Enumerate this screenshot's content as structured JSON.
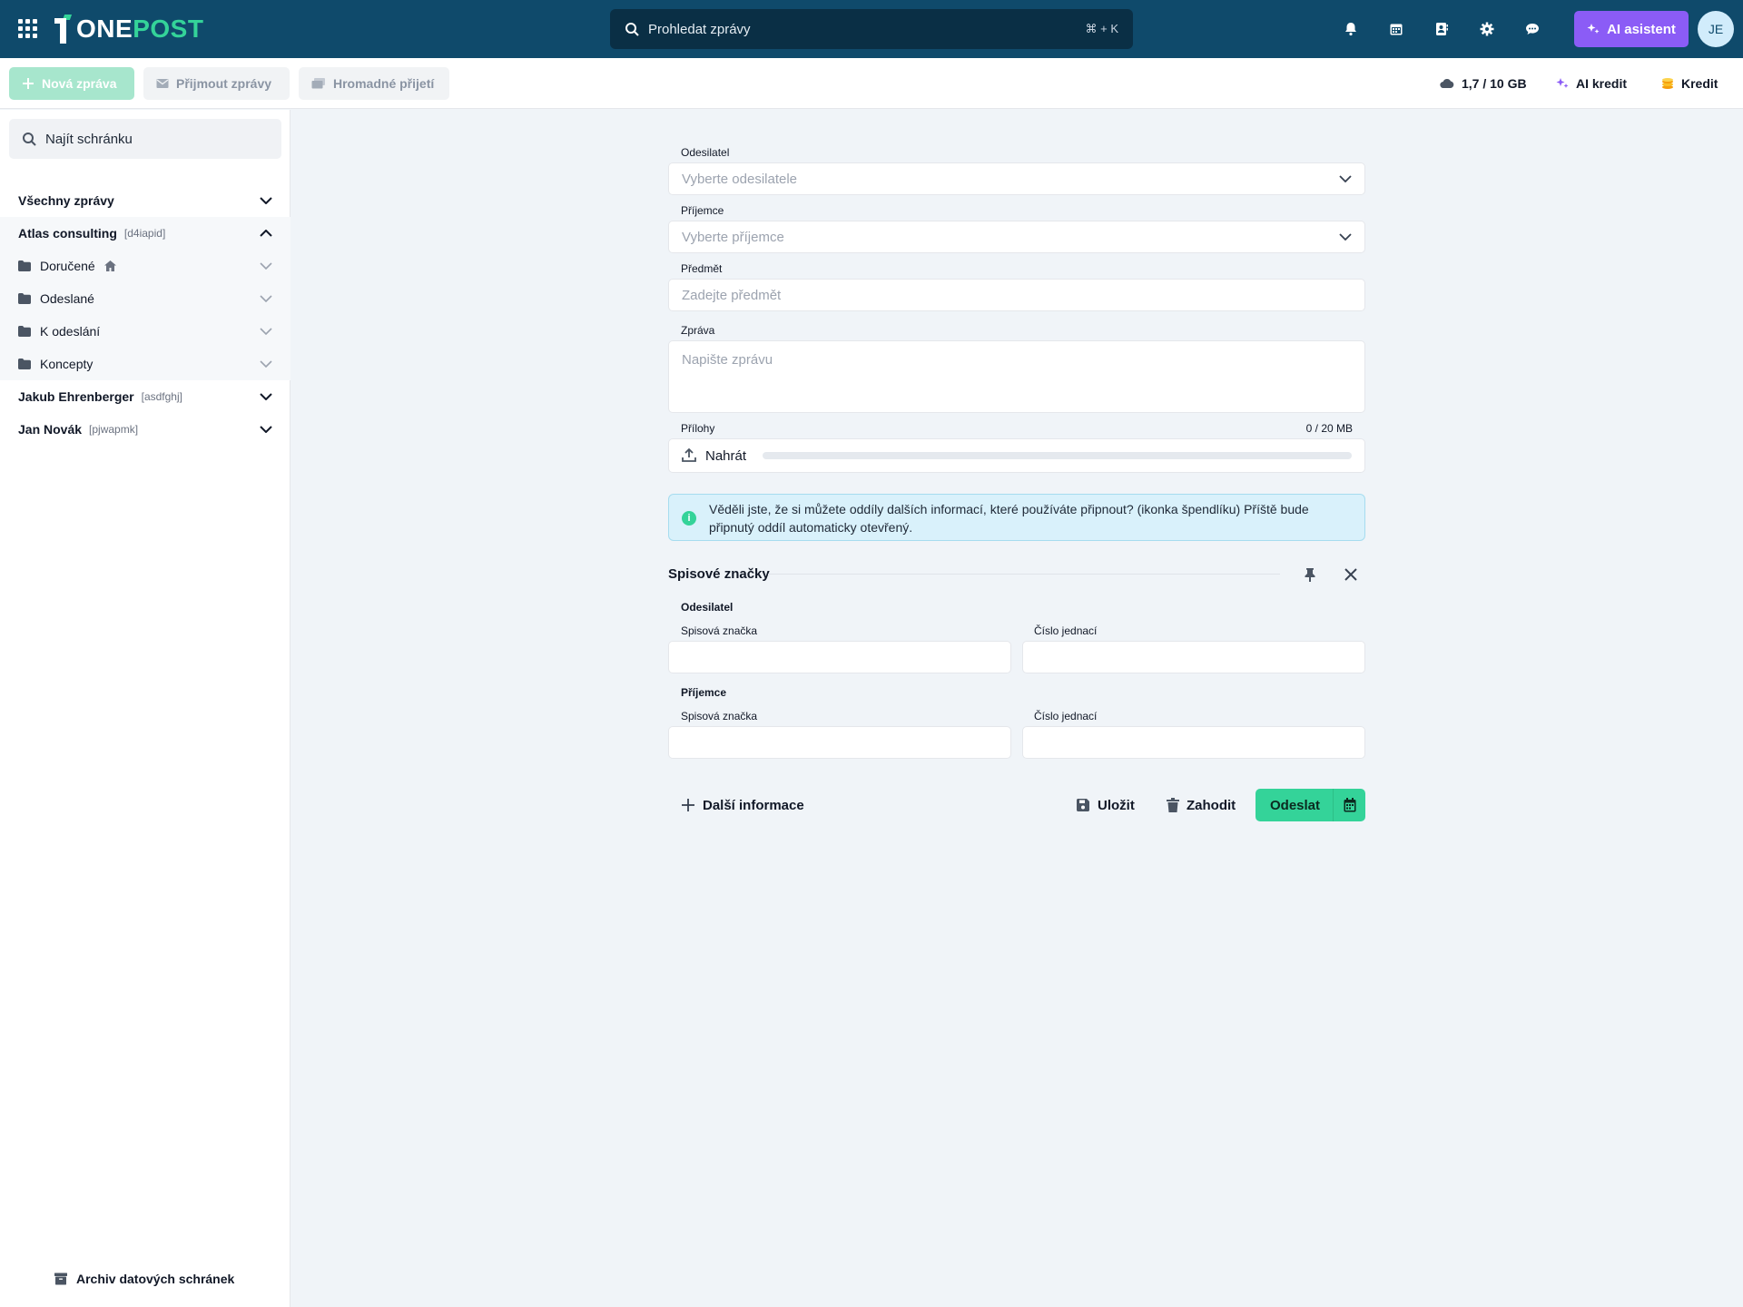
{
  "header": {
    "logo": {
      "one": "ONE",
      "post": "POST"
    },
    "search_placeholder": "Prohledat zprávy",
    "search_shortcut": "⌘ + K",
    "ai_button": "AI asistent",
    "avatar_initials": "JE"
  },
  "toolbar": {
    "new_message": "Nová zpráva",
    "receive_messages": "Přijmout zprávy",
    "bulk_receive": "Hromadné přijetí",
    "storage": "1,7 / 10 GB",
    "ai_credit": "AI kredit",
    "credit": "Kredit"
  },
  "sidebar": {
    "search_placeholder": "Najít schránku",
    "all_messages": "Všechny zprávy",
    "mailboxes": [
      {
        "name": "Atlas consulting",
        "code": "[d4iapid]"
      },
      {
        "name": "Jakub Ehrenberger",
        "code": "[asdfghj]"
      },
      {
        "name": "Jan Novák",
        "code": "[pjwapmk]"
      }
    ],
    "folders": [
      "Doručené",
      "Odeslané",
      "K odeslání",
      "Koncepty"
    ],
    "archive": "Archiv datových schránek"
  },
  "form": {
    "sender_label": "Odesilatel",
    "sender_placeholder": "Vyberte odesilatele",
    "recipient_label": "Příjemce",
    "recipient_placeholder": "Vyberte příjemce",
    "subject_label": "Předmět",
    "subject_placeholder": "Zadejte předmět",
    "message_label": "Zpráva",
    "message_placeholder": "Napište zprávu",
    "attachments_label": "Přílohy",
    "attachments_size": "0 / 20 MB",
    "upload_label": "Nahrát",
    "attachments_used_fraction": 0,
    "info_text": "Věděli jste, že si můžete oddíly dalších informací, které používáte připnout? (ikonka špendlíku) Příště bude připnutý oddíl automaticky otevřený."
  },
  "reference_section": {
    "title": "Spisové značky",
    "sender_heading": "Odesilatel",
    "recipient_heading": "Příjemce",
    "file_mark_label": "Spisová značka",
    "ref_number_label": "Číslo jednací"
  },
  "actions": {
    "more_info": "Další informace",
    "save": "Uložit",
    "discard": "Zahodit",
    "send": "Odeslat"
  },
  "colors": {
    "header_bg": "#0f4a6b",
    "accent_green": "#34d399",
    "ai_purple": "#8b5cf6"
  }
}
